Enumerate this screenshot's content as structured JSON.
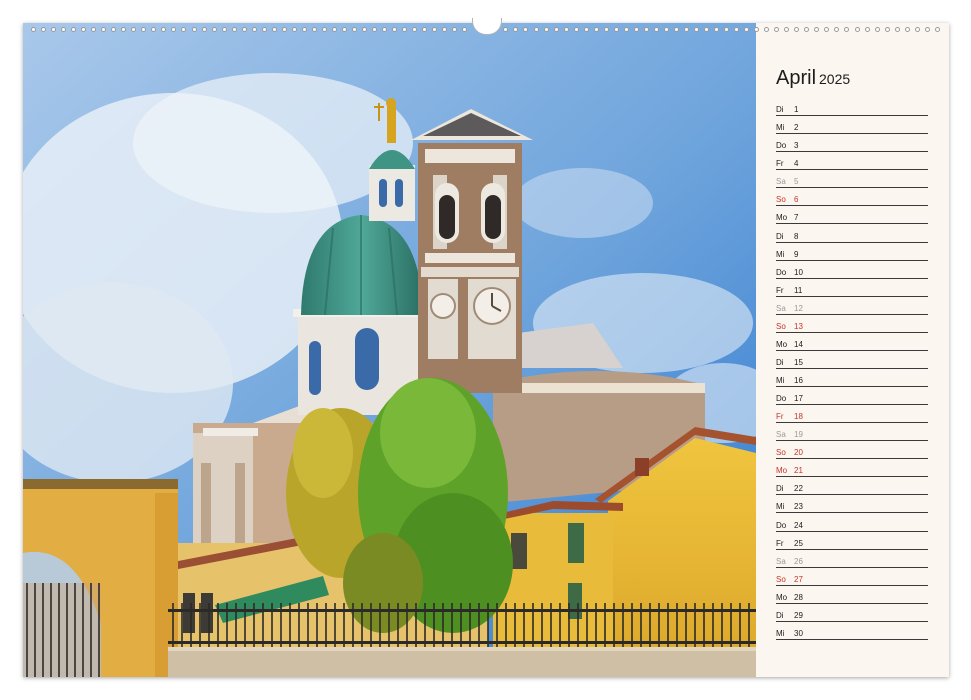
{
  "calendar": {
    "month": "April",
    "year": "2025",
    "days": [
      {
        "wd": "Di",
        "d": "1",
        "type": "weekday"
      },
      {
        "wd": "Mi",
        "d": "2",
        "type": "weekday"
      },
      {
        "wd": "Do",
        "d": "3",
        "type": "weekday"
      },
      {
        "wd": "Fr",
        "d": "4",
        "type": "weekday"
      },
      {
        "wd": "Sa",
        "d": "5",
        "type": "sat"
      },
      {
        "wd": "So",
        "d": "6",
        "type": "sun"
      },
      {
        "wd": "Mo",
        "d": "7",
        "type": "weekday"
      },
      {
        "wd": "Di",
        "d": "8",
        "type": "weekday"
      },
      {
        "wd": "Mi",
        "d": "9",
        "type": "weekday"
      },
      {
        "wd": "Do",
        "d": "10",
        "type": "weekday"
      },
      {
        "wd": "Fr",
        "d": "11",
        "type": "weekday"
      },
      {
        "wd": "Sa",
        "d": "12",
        "type": "sat"
      },
      {
        "wd": "So",
        "d": "13",
        "type": "sun"
      },
      {
        "wd": "Mo",
        "d": "14",
        "type": "weekday"
      },
      {
        "wd": "Di",
        "d": "15",
        "type": "weekday"
      },
      {
        "wd": "Mi",
        "d": "16",
        "type": "weekday"
      },
      {
        "wd": "Do",
        "d": "17",
        "type": "weekday"
      },
      {
        "wd": "Fr",
        "d": "18",
        "type": "holiday"
      },
      {
        "wd": "Sa",
        "d": "19",
        "type": "sat"
      },
      {
        "wd": "So",
        "d": "20",
        "type": "sun"
      },
      {
        "wd": "Mo",
        "d": "21",
        "type": "holiday"
      },
      {
        "wd": "Di",
        "d": "22",
        "type": "weekday"
      },
      {
        "wd": "Mi",
        "d": "23",
        "type": "weekday"
      },
      {
        "wd": "Do",
        "d": "24",
        "type": "weekday"
      },
      {
        "wd": "Fr",
        "d": "25",
        "type": "weekday"
      },
      {
        "wd": "Sa",
        "d": "26",
        "type": "sat"
      },
      {
        "wd": "So",
        "d": "27",
        "type": "sun"
      },
      {
        "wd": "Mo",
        "d": "28",
        "type": "weekday"
      },
      {
        "wd": "Di",
        "d": "29",
        "type": "weekday"
      },
      {
        "wd": "Mi",
        "d": "30",
        "type": "weekday"
      }
    ]
  },
  "colors": {
    "sky": "#3f86d6",
    "dome": "#3d8f82",
    "facade": "#e8c540",
    "sunday": "#c8332b",
    "saturday": "#9a9a9a"
  },
  "photo": {
    "subject_icon": "cathedral-photo"
  }
}
